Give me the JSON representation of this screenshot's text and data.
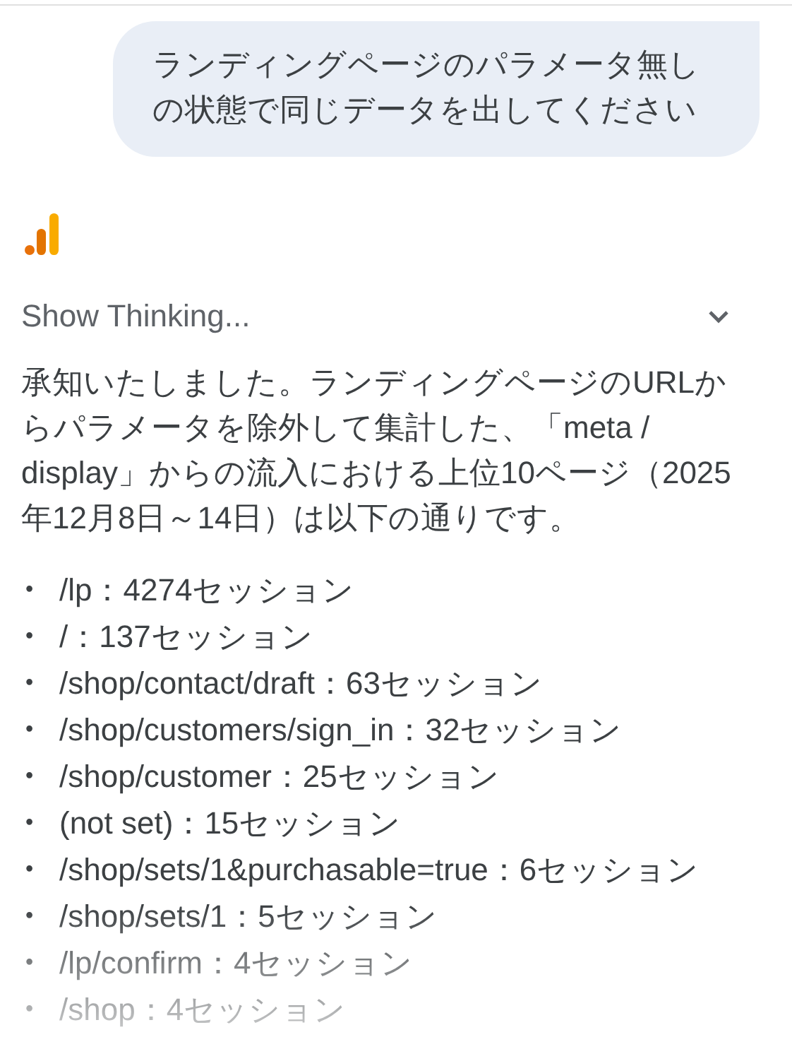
{
  "user_message": {
    "text": "ランディングページのパラメータ無しの状態で同じデータを出してください"
  },
  "response": {
    "thinking_toggle": {
      "label": "Show Thinking...",
      "expanded": false
    },
    "intro": "承知いたしました。ランディングページのURLからパラメータを除外して集計した、「meta / display」からの流入における上位10ページ（2025年12月8日～14日）は以下の通りです。",
    "items": [
      {
        "bullet": "•",
        "text": "/lp：4274セッション"
      },
      {
        "bullet": "•",
        "text": "/：137セッション"
      },
      {
        "bullet": "•",
        "text": "/shop/contact/draft：63セッション"
      },
      {
        "bullet": "•",
        "text": "/shop/customers/sign_in：32セッション"
      },
      {
        "bullet": "•",
        "text": "/shop/customer：25セッション"
      },
      {
        "bullet": "•",
        "text": "(not set)：15セッション"
      },
      {
        "bullet": "•",
        "text": "/shop/sets/1&purchasable=true：6セッション"
      },
      {
        "bullet": "•",
        "text": "/shop/sets/1：5セッション"
      },
      {
        "bullet": "•",
        "text": "/lp/confirm：4セッション"
      },
      {
        "bullet": "•",
        "text": "/shop：4セッション"
      }
    ]
  }
}
